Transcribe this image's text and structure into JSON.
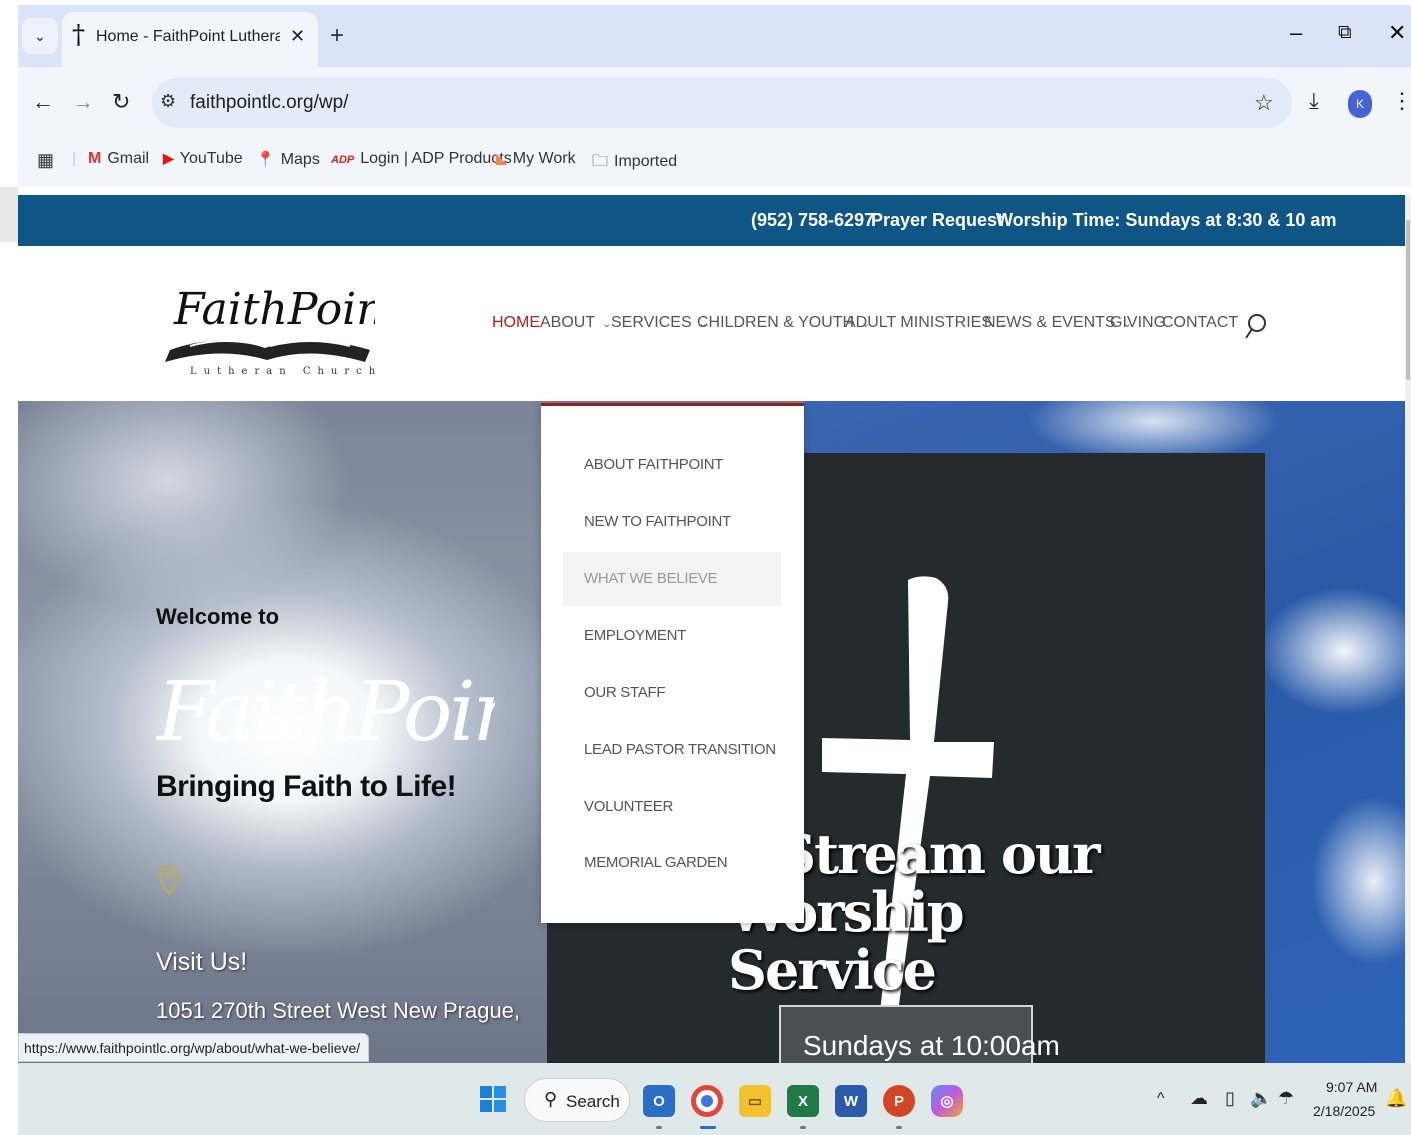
{
  "browser": {
    "tab_title": "Home - FaithPoint Lutheran Ch",
    "tab_favicon": "†",
    "tab_close": "✕",
    "new_tab": "+",
    "url": "faithpointlc.org/wp/",
    "profile_initial": "K",
    "bookmarks": [
      {
        "label": "Gmail",
        "icon": "M"
      },
      {
        "label": "YouTube",
        "icon": "▶"
      },
      {
        "label": "Maps",
        "icon": "📍"
      },
      {
        "label": "Login | ADP Products",
        "icon": "ADP"
      },
      {
        "label": "My Work",
        "icon": "◣"
      },
      {
        "label": "Imported",
        "icon": "🗀"
      }
    ]
  },
  "site": {
    "topbar": {
      "phone": "(952) 758-6297",
      "prayer": "Prayer Request",
      "worship": "Worship Time: Sundays at 8:30 & 10 am"
    },
    "logo": {
      "name": "FaithPoint",
      "sub": "Lutheran Church"
    },
    "nav": [
      {
        "label": "HOME",
        "dropdown": false
      },
      {
        "label": "ABOUT",
        "dropdown": true
      },
      {
        "label": "SERVICES",
        "dropdown": true
      },
      {
        "label": "CHILDREN & YOUTH",
        "dropdown": true
      },
      {
        "label": "ADULT MINISTRIES",
        "dropdown": true
      },
      {
        "label": "NEWS & EVENTS",
        "dropdown": true
      },
      {
        "label": "GIVING",
        "dropdown": false
      },
      {
        "label": "CONTACT",
        "dropdown": false
      }
    ],
    "about_dropdown": [
      "ABOUT FAITHPOINT",
      "NEW TO FAITHPOINT",
      "WHAT WE BELIEVE",
      "EMPLOYMENT",
      "OUR STAFF",
      "LEAD PASTOR TRANSITION",
      "VOLUNTEER",
      "MEMORIAL GARDEN"
    ],
    "hero": {
      "welcome": "Welcome to",
      "script": "FaithPoint",
      "tagline": "Bringing Faith to Life!",
      "visit": "Visit Us!",
      "address": "1051 270th Street West New Prague,",
      "stream_line1": "e Stream our",
      "stream_line2": "Worship Service",
      "sundays": "Sundays at 10:00am"
    }
  },
  "status_url": "https://www.faithpointlc.org/wp/about/what-we-believe/",
  "taskbar": {
    "search_label": "Search",
    "time": "9:07 AM",
    "date": "2/18/2025"
  },
  "colors": {
    "topbar": "#0f5686",
    "nav_active": "#b51d1d",
    "dropdown_accent": "#8d1f1f"
  }
}
